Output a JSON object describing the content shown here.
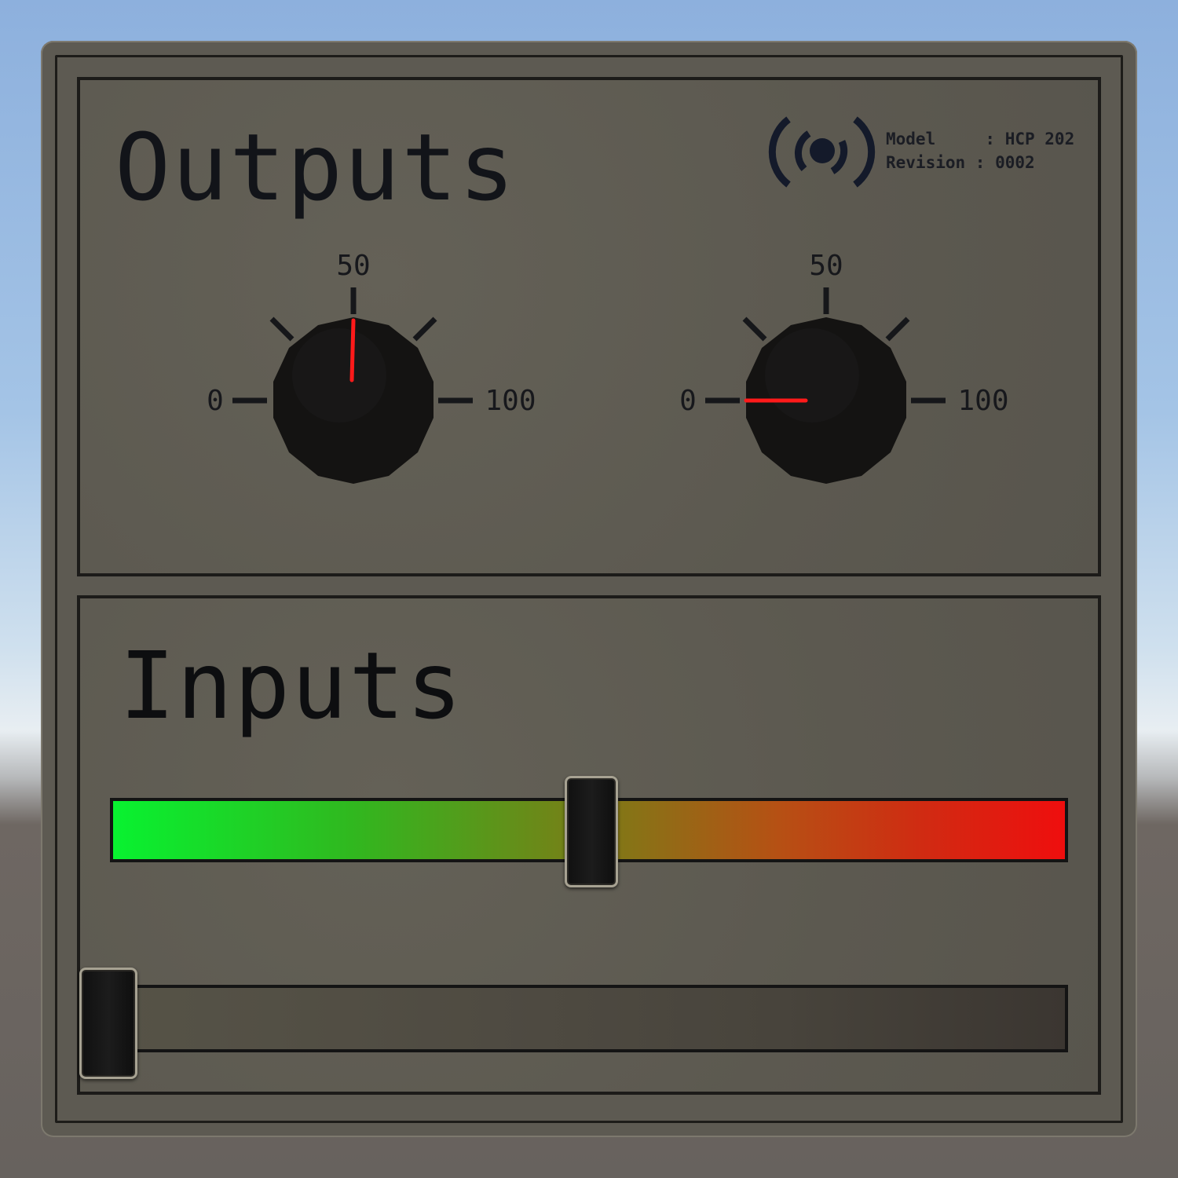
{
  "outputs": {
    "title": "Outputs",
    "model_line": "Model     : HCP 202",
    "revision_line": "Revision : 0002",
    "logo_icon": "broadcast-signal-icon",
    "knobs": [
      {
        "min_label": "0",
        "mid_label": "50",
        "max_label": "100",
        "value": 50
      },
      {
        "min_label": "0",
        "mid_label": "50",
        "max_label": "100",
        "value": 0
      }
    ],
    "indicator_color": "#ff1a1a"
  },
  "inputs": {
    "title": "Inputs",
    "sliders": [
      {
        "value_fraction": 0.5,
        "track_colors": [
          "#08f230",
          "#ef0e0e"
        ]
      },
      {
        "value_fraction": 0.0,
        "track_colors": [
          "#565347",
          "#3b3631"
        ]
      }
    ]
  }
}
